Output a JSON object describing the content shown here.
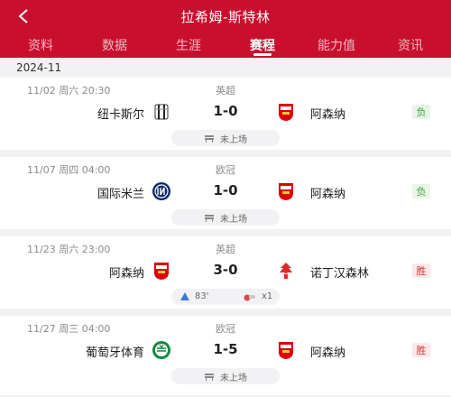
{
  "header": {
    "title": "拉希姆-斯特林"
  },
  "tabs": [
    {
      "label": "资料"
    },
    {
      "label": "数据"
    },
    {
      "label": "生涯"
    },
    {
      "label": "赛程"
    },
    {
      "label": "能力值"
    },
    {
      "label": "资讯"
    }
  ],
  "active_tab": "赛程",
  "month": "2024-11",
  "matches": [
    {
      "date": "11/02  周六 20:30",
      "league": "英超",
      "home": "纽卡斯尔",
      "home_logo": "newcastle-logo",
      "score": "1-0",
      "away": "阿森纳",
      "away_logo": "arsenal-logo",
      "result": "负",
      "status": "未上场"
    },
    {
      "date": "11/07  周四 04:00",
      "league": "欧冠",
      "home": "国际米兰",
      "home_logo": "inter-logo",
      "score": "1-0",
      "away": "阿森纳",
      "away_logo": "arsenal-logo",
      "result": "负",
      "status": "未上场"
    },
    {
      "date": "11/23  周六 23:00",
      "league": "英超",
      "home": "阿森纳",
      "home_logo": "arsenal-logo",
      "score": "3-0",
      "away": "诺丁汉森林",
      "away_logo": "nottingham-logo",
      "result": "胜",
      "events": {
        "sub_in_minute": "83'",
        "card_count": "x1"
      }
    },
    {
      "date": "11/27  周三 04:00",
      "league": "欧冠",
      "home": "葡萄牙体育",
      "home_logo": "sporting-logo",
      "score": "1-5",
      "away": "阿森纳",
      "away_logo": "arsenal-logo",
      "result": "胜",
      "status": "未上场"
    }
  ],
  "colors": {
    "brand": "#c8102e",
    "loss_text": "#3aa13a",
    "win_text": "#d03333"
  }
}
